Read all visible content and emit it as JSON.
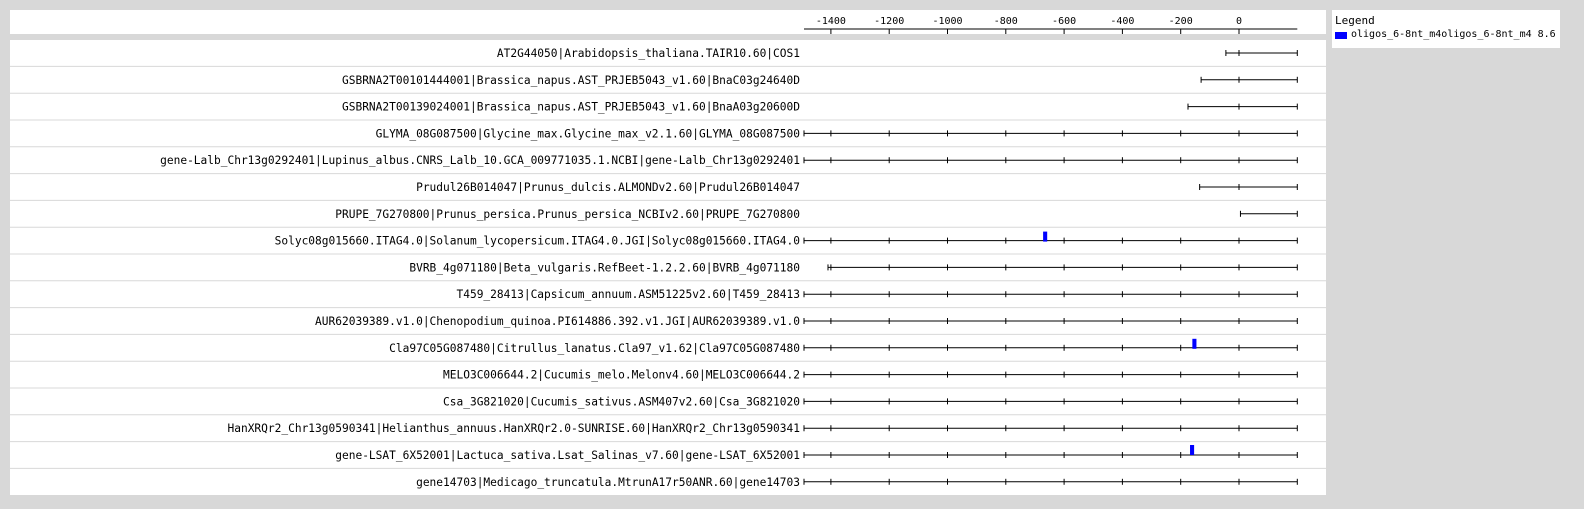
{
  "chart_data": {
    "type": "track",
    "x_ticks": [
      -1400,
      -1200,
      -1000,
      -800,
      -600,
      -400,
      -200,
      0
    ],
    "x_max": 200,
    "legend": {
      "title": "Legend",
      "entries": [
        {
          "label": "oligos_6-8nt_m4oligos_6-8nt_m4 8.6",
          "color": "#0000ff"
        }
      ]
    },
    "rows": [
      {
        "label": "AT2G44050|Arabidopsis_thaliana.TAIR10.60|COS1",
        "start": -45,
        "end": 200,
        "hits": []
      },
      {
        "label": "GSBRNA2T00101444001|Brassica_napus.AST_PRJEB5043_v1.60|BnaC03g24640D",
        "start": -130,
        "end": 200,
        "hits": []
      },
      {
        "label": "GSBRNA2T00139024001|Brassica_napus.AST_PRJEB5043_v1.60|BnaA03g20600D",
        "start": -175,
        "end": 200,
        "hits": []
      },
      {
        "label": "GLYMA_08G087500|Glycine_max.Glycine_max_v2.1.60|GLYMA_08G087500",
        "start": -1500,
        "end": 200,
        "hits": []
      },
      {
        "label": "gene-Lalb_Chr13g0292401|Lupinus_albus.CNRS_Lalb_10.GCA_009771035.1.NCBI|gene-Lalb_Chr13g0292401",
        "start": -1500,
        "end": 200,
        "hits": []
      },
      {
        "label": "Prudul26B014047|Prunus_dulcis.ALMONDv2.60|Prudul26B014047",
        "start": -135,
        "end": 200,
        "hits": []
      },
      {
        "label": "PRUPE_7G270800|Prunus_persica.Prunus_persica_NCBIv2.60|PRUPE_7G270800",
        "start": 5,
        "end": 200,
        "hits": []
      },
      {
        "label": "Solyc08g015660.ITAG4.0|Solanum_lycopersicum.ITAG4.0.JGI|Solyc08g015660.ITAG4.0",
        "start": -1500,
        "end": 200,
        "hits": [
          {
            "start": -672,
            "end": -658,
            "strand": "+"
          }
        ]
      },
      {
        "label": "BVRB_4g071180|Beta_vulgaris.RefBeet-1.2.2.60|BVRB_4g071180",
        "start": -1410,
        "end": 200,
        "hits": []
      },
      {
        "label": "T459_28413|Capsicum_annuum.ASM51225v2.60|T459_28413",
        "start": -1500,
        "end": 200,
        "hits": []
      },
      {
        "label": "AUR62039389.v1.0|Chenopodium_quinoa.PI614886.392.v1.JGI|AUR62039389.v1.0",
        "start": -1500,
        "end": 200,
        "hits": []
      },
      {
        "label": "Cla97C05G087480|Citrullus_lanatus.Cla97_v1.62|Cla97C05G087480",
        "start": -1500,
        "end": 200,
        "hits": [
          {
            "start": -160,
            "end": -146,
            "strand": "+"
          }
        ]
      },
      {
        "label": "MELO3C006644.2|Cucumis_melo.Melonv4.60|MELO3C006644.2",
        "start": -1500,
        "end": 200,
        "hits": []
      },
      {
        "label": "Csa_3G821020|Cucumis_sativus.ASM407v2.60|Csa_3G821020",
        "start": -1500,
        "end": 200,
        "hits": []
      },
      {
        "label": "HanXRQr2_Chr13g0590341|Helianthus_annuus.HanXRQr2.0-SUNRISE.60|HanXRQr2_Chr13g0590341",
        "start": -1500,
        "end": 200,
        "hits": []
      },
      {
        "label": "gene-LSAT_6X52001|Lactuca_sativa.Lsat_Salinas_v7.60|gene-LSAT_6X52001",
        "start": -1500,
        "end": 200,
        "hits": [
          {
            "start": -168,
            "end": -154,
            "strand": "-"
          }
        ]
      },
      {
        "label": "gene14703|Medicago_truncatula.MtrunA17r50ANR.60|gene14703",
        "start": -1500,
        "end": 200,
        "hits": []
      }
    ]
  }
}
